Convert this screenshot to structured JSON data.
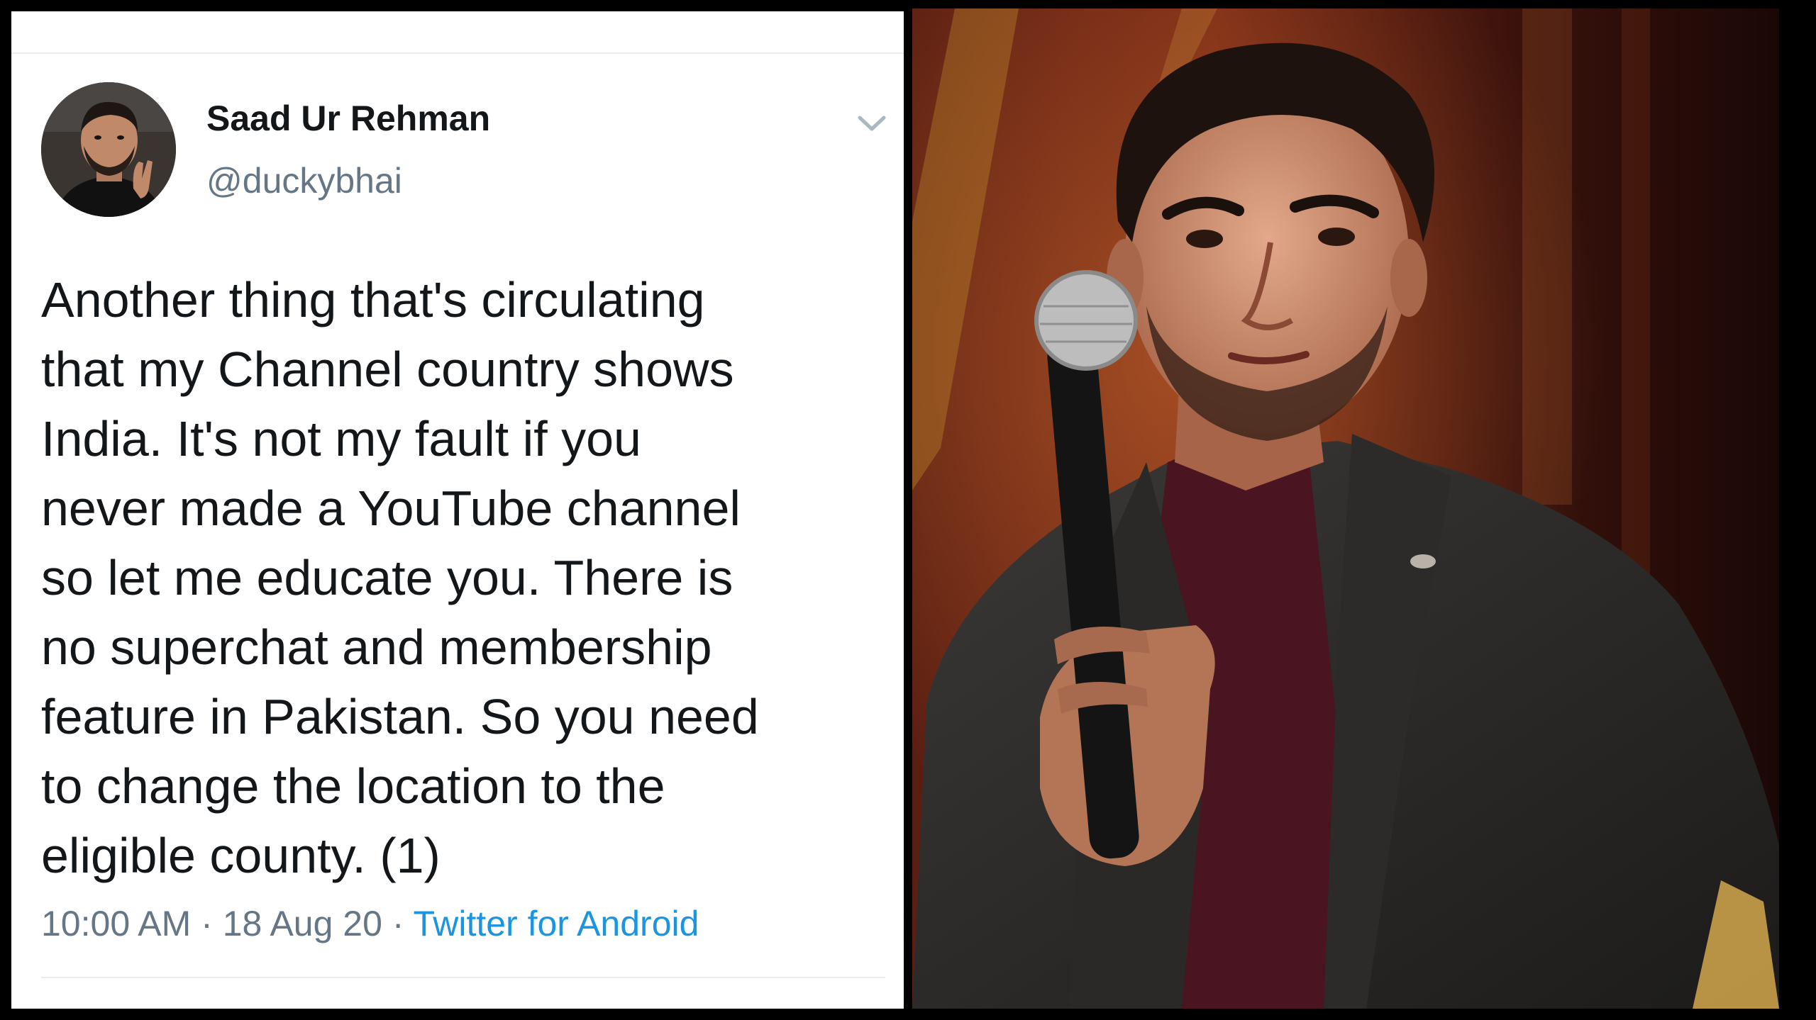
{
  "tweet": {
    "display_name": "Saad Ur Rehman",
    "handle": "@duckybhai",
    "text_lines": [
      "Another thing that's circulating",
      "that my Channel country shows",
      "India. It's not my fault if you",
      "never made a YouTube channel",
      "so let me educate you. There is",
      "no superchat and membership",
      "feature in Pakistan. So you need",
      "to change the location to the",
      "eligible county. (1)"
    ],
    "time": "10:00 AM",
    "separator": " · ",
    "date": "18 Aug 20",
    "source": "Twitter for Android",
    "menu_icon": "chevron-down-icon"
  },
  "colors": {
    "name_text": "#14171a",
    "secondary_text": "#657786",
    "link": "#1b95e0",
    "divider": "#e6ecf0"
  },
  "photo": {
    "subject": "man-holding-microphone-photo"
  }
}
